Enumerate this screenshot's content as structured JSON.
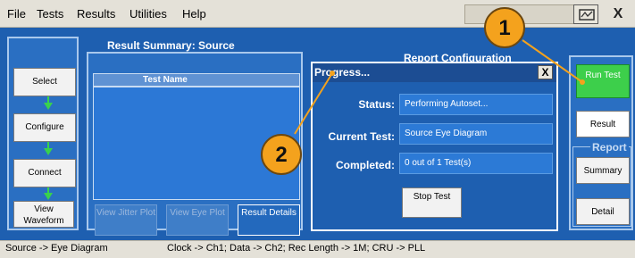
{
  "menu": {
    "items": [
      "File",
      "Tests",
      "Results",
      "Utilities",
      "Help"
    ]
  },
  "window_close": "X",
  "nav": {
    "select": "Select",
    "configure": "Configure",
    "connect": "Connect",
    "view_waveform": "View Waveform"
  },
  "result_summary": {
    "title": "Result Summary: Source",
    "column_header": "Test Name",
    "buttons": {
      "view_jitter_plot": "View Jitter Plot",
      "view_eye_plot": "View Eye Plot",
      "result_details": "Result Details"
    }
  },
  "report_configuration_title": "Report Configuration",
  "dialog": {
    "title": "Progress...",
    "close": "X",
    "status_label": "Status:",
    "status_value": "Performing Autoset...",
    "current_test_label": "Current Test:",
    "current_test_value": "Source Eye Diagram",
    "completed_label": "Completed:",
    "completed_value": "0 out of 1 Test(s)",
    "stop_button": "Stop Test"
  },
  "right_panel": {
    "run_test": "Run Test",
    "result": "Result",
    "report_group": "Report",
    "summary": "Summary",
    "detail": "Detail"
  },
  "status_bar": {
    "left": "Source -> Eye Diagram",
    "right": "Clock -> Ch1; Data -> Ch2; Rec Length -> 1M; CRU -> PLL"
  },
  "callouts": {
    "one": "1",
    "two": "2"
  },
  "colors": {
    "main_blue": "#1e5fb0",
    "run_green": "#3dcf4b",
    "callout_orange": "#f4a21d",
    "arrow_green": "#39d24d"
  }
}
